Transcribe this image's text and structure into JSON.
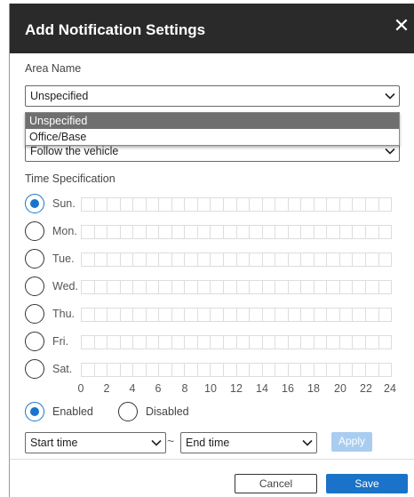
{
  "dialog": {
    "title": "Add Notification Settings",
    "close_glyph": "✕"
  },
  "area": {
    "label": "Area Name",
    "value": "Unspecified",
    "options": [
      "Unspecified",
      "Office/Base"
    ]
  },
  "vehicle": {
    "value": "Follow the vehicle"
  },
  "time_spec": {
    "label": "Time Specification",
    "days": [
      "Sun.",
      "Mon.",
      "Tue.",
      "Wed.",
      "Thu.",
      "Fri.",
      "Sat."
    ],
    "selected_day": "Sun.",
    "hour_ticks": [
      "0",
      "2",
      "4",
      "6",
      "8",
      "10",
      "12",
      "14",
      "16",
      "18",
      "20",
      "22",
      "24"
    ]
  },
  "status": {
    "enabled_label": "Enabled",
    "disabled_label": "Disabled",
    "selected": "Enabled"
  },
  "time_range": {
    "start_placeholder": "Start time",
    "separator": "~",
    "end_placeholder": "End time",
    "apply_label": "Apply"
  },
  "footer": {
    "cancel_label": "Cancel",
    "save_label": "Save"
  },
  "colors": {
    "accent": "#1a73c8",
    "header_bg": "#2a2a2a",
    "apply_disabled": "#a9cdf0"
  }
}
